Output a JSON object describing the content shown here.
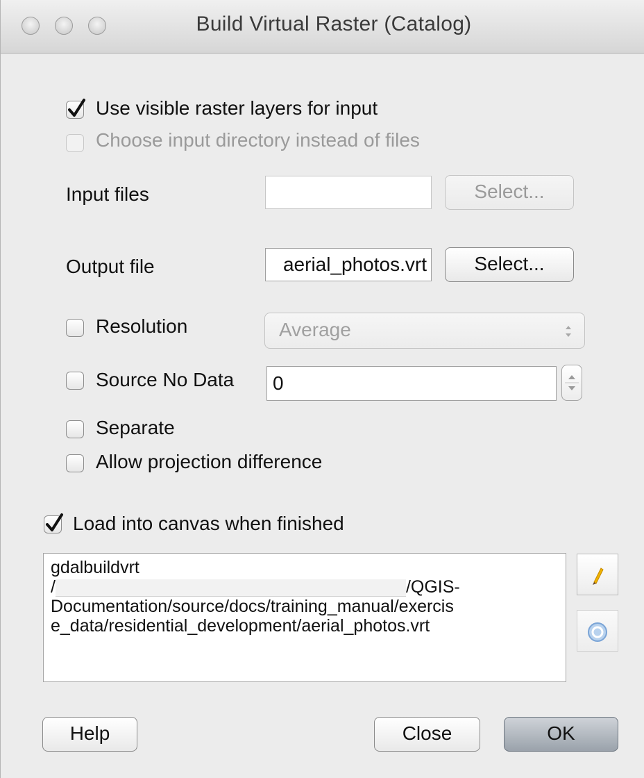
{
  "window": {
    "title": "Build Virtual Raster (Catalog)"
  },
  "options": {
    "use_visible_label": "Use visible raster layers for input",
    "use_visible_checked": true,
    "input_dir_label": "Choose input directory instead of files",
    "input_dir_checked": false
  },
  "input_files": {
    "label": "Input files",
    "value": "",
    "select_label": "Select..."
  },
  "output_file": {
    "label": "Output file",
    "value": "aerial_photos.vrt",
    "select_label": "Select..."
  },
  "resolution": {
    "label": "Resolution",
    "checked": false,
    "selected": "Average"
  },
  "source_nodata": {
    "label": "Source No Data",
    "checked": false,
    "value": "0"
  },
  "separate": {
    "label": "Separate",
    "checked": false
  },
  "allow_projection": {
    "label": "Allow projection difference",
    "checked": false
  },
  "load_canvas": {
    "label": "Load into canvas when finished",
    "checked": true
  },
  "command": {
    "line1": "gdalbuildvrt",
    "line2_prefix": "/",
    "line2_suffix": "/QGIS-",
    "line3": "Documentation/source/docs/training_manual/exercis",
    "line4": "e_data/residential_development/aerial_photos.vrt"
  },
  "icons": {
    "edit": "pencil-icon",
    "reset": "reset-icon"
  },
  "buttons": {
    "help": "Help",
    "close": "Close",
    "ok": "OK"
  }
}
